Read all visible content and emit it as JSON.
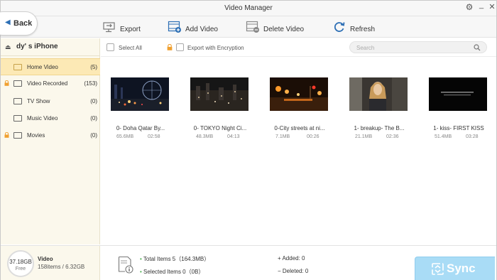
{
  "window": {
    "title": "Video Manager"
  },
  "toolbar": {
    "back_label": "Back",
    "export_label": "Export",
    "add_video_label": "Add Video",
    "delete_video_label": "Delete Video",
    "refresh_label": "Refresh"
  },
  "sidebar": {
    "device_name": "dy' s iPhone",
    "items": [
      {
        "label": "Home Video",
        "count": "(5)",
        "locked": false,
        "active": true,
        "icon": "home-video-icon"
      },
      {
        "label": "Video Recorded",
        "count": "(153)",
        "locked": true,
        "active": false,
        "icon": "video-recorded-icon"
      },
      {
        "label": "TV Show",
        "count": "(0)",
        "locked": false,
        "active": false,
        "icon": "tv-show-icon"
      },
      {
        "label": "Music Video",
        "count": "(0)",
        "locked": false,
        "active": false,
        "icon": "music-video-icon"
      },
      {
        "label": "Movies",
        "count": "(0)",
        "locked": true,
        "active": false,
        "icon": "movies-icon"
      }
    ]
  },
  "actionbar": {
    "select_all_label": "Select All",
    "export_encryption_label": "Export with Encryption",
    "search_placeholder": "Search"
  },
  "videos": [
    {
      "name": "0- Doha Qatar By...",
      "size": "65.6MB",
      "duration": "02:58"
    },
    {
      "name": "0- TOKYO Night Ci...",
      "size": "48.3MB",
      "duration": "04:13"
    },
    {
      "name": "0-City streets at ni...",
      "size": "7.1MB",
      "duration": "00:26"
    },
    {
      "name": "1- breakup- The B...",
      "size": "21.1MB",
      "duration": "02:36"
    },
    {
      "name": "1- kiss- FIRST KISS",
      "size": "51.4MB",
      "duration": "03:28"
    }
  ],
  "footer": {
    "storage_free": "37.18GB",
    "storage_free_label": "Free",
    "category": "Video",
    "category_detail": "158items / 6.32GB",
    "total_items": "Total Items 5（164.3MB）",
    "selected_items": "Selected Items 0（0B）",
    "added": "Added: 0",
    "deleted": "Deleted: 0",
    "sync_label": "Sync"
  },
  "colors": {
    "accent_blue": "#2d6fb5",
    "sidebar_bg": "#fbf8ec",
    "active_item_bg": "#fce9b5",
    "sync_bg": "#a9dcf6",
    "lock_orange": "#f0a030"
  }
}
